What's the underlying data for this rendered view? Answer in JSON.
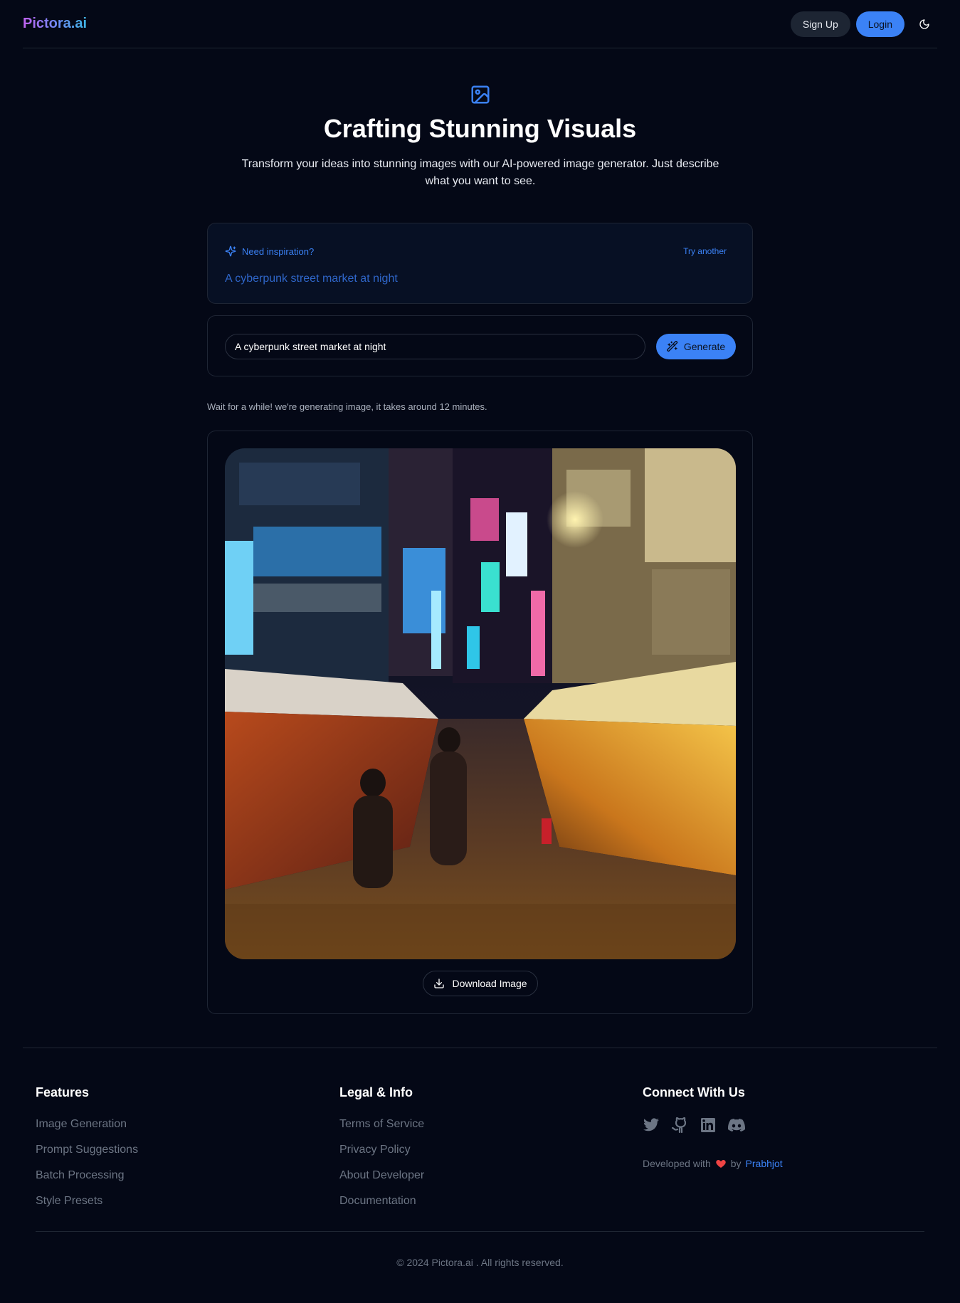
{
  "header": {
    "logo": "Pictora.ai",
    "signup_label": "Sign Up",
    "login_label": "Login",
    "theme_icon": "moon-icon"
  },
  "hero": {
    "icon": "image-icon",
    "title": "Crafting Stunning Visuals",
    "subtitle": "Transform your ideas into stunning images with our AI-powered image generator. Just describe what you want to see."
  },
  "inspiration": {
    "icon": "sparkles-icon",
    "label": "Need inspiration?",
    "try_another_label": "Try another",
    "prompt": "A cyberpunk street market at night"
  },
  "form": {
    "input_value": "A cyberpunk street market at night",
    "generate_icon": "magic-wand-icon",
    "generate_label": "Generate"
  },
  "status": {
    "wait_message": "Wait for a while! we're generating image, it takes around 12 minutes."
  },
  "result": {
    "download_icon": "download-icon",
    "download_label": "Download Image"
  },
  "footer": {
    "features": {
      "title": "Features",
      "items": [
        "Image Generation",
        "Prompt Suggestions",
        "Batch Processing",
        "Style Presets"
      ]
    },
    "legal": {
      "title": "Legal & Info",
      "items": [
        "Terms of Service",
        "Privacy Policy",
        "About Developer",
        "Documentation"
      ]
    },
    "connect": {
      "title": "Connect With Us",
      "socials": [
        "twitter-icon",
        "github-icon",
        "linkedin-icon",
        "discord-icon"
      ],
      "dev_prefix": "Developed with",
      "dev_by": "by",
      "dev_name": "Prabhjot"
    },
    "copyright": "© 2024 Pictora.ai . All rights reserved."
  },
  "colors": {
    "background": "#040816",
    "accent": "#3b82f6",
    "muted_text": "#6c7584",
    "border": "#1e2534",
    "heart": "#ef4444"
  }
}
